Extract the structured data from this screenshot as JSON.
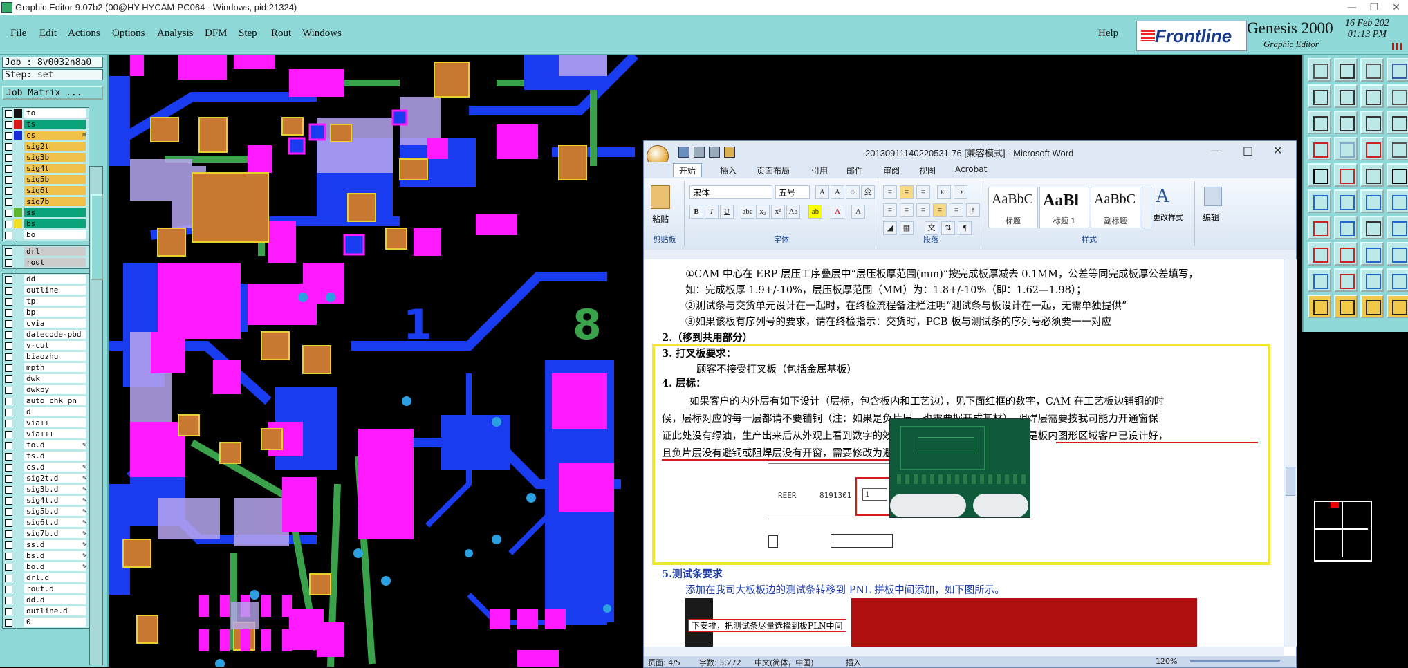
{
  "window": {
    "title": "Graphic Editor 9.07b2 (00@HY-HYCAM-PC064 - Windows, pid:21324)"
  },
  "menu": {
    "items": [
      "File",
      "Edit",
      "Actions",
      "Options",
      "Analysis",
      "DFM",
      "Step",
      "Rout",
      "Windows"
    ],
    "help": "Help"
  },
  "brand": {
    "logo_text": "Frontline",
    "product": "Genesis 2000",
    "subtitle": "Graphic Editor",
    "date_line1": "16 Feb 202",
    "time_line2": "01:13 PM"
  },
  "job": {
    "job_label": "Job : 8v0032n8a0",
    "step_label": "Step: set",
    "matrix_button": "Job Matrix ..."
  },
  "layers_group1": [
    {
      "name": "to",
      "swatch": "#111111",
      "bg": "#ffffff"
    },
    {
      "name": "ts",
      "swatch": "#d81818",
      "bg": "#0aa37a"
    },
    {
      "name": "cs",
      "swatch": "#1a2cd8",
      "bg": "#f0c24a",
      "edit": "≡"
    },
    {
      "name": "sig2t",
      "swatch": "",
      "bg": "#f0c24a"
    },
    {
      "name": "sig3b",
      "swatch": "",
      "bg": "#f0c24a"
    },
    {
      "name": "sig4t",
      "swatch": "",
      "bg": "#f0c24a"
    },
    {
      "name": "sig5b",
      "swatch": "",
      "bg": "#f0c24a"
    },
    {
      "name": "sig6t",
      "swatch": "",
      "bg": "#f0c24a"
    },
    {
      "name": "sig7b",
      "swatch": "",
      "bg": "#f0c24a"
    },
    {
      "name": "ss",
      "swatch": "#5ab82a",
      "bg": "#0aa37a"
    },
    {
      "name": "bs",
      "swatch": "#f0e020",
      "bg": "#0aa37a"
    },
    {
      "name": "bo",
      "swatch": "",
      "bg": "#ffffff"
    }
  ],
  "layers_group2": [
    {
      "name": "drl",
      "bg": "#cccccc"
    },
    {
      "name": "rout",
      "bg": "#cccccc"
    }
  ],
  "layers_group3": [
    {
      "name": "dd",
      "edit": ""
    },
    {
      "name": "outline",
      "edit": ""
    },
    {
      "name": "tp",
      "edit": ""
    },
    {
      "name": "bp",
      "edit": ""
    },
    {
      "name": "cvia",
      "edit": ""
    },
    {
      "name": "datecode-pbd",
      "edit": ""
    },
    {
      "name": "v-cut",
      "edit": ""
    },
    {
      "name": "biaozhu",
      "edit": ""
    },
    {
      "name": "mpth",
      "edit": ""
    },
    {
      "name": "dwk",
      "edit": ""
    },
    {
      "name": "dwkby",
      "edit": ""
    },
    {
      "name": "auto_chk_pn",
      "edit": ""
    },
    {
      "name": "d",
      "edit": ""
    },
    {
      "name": "via++",
      "edit": ""
    },
    {
      "name": "via+++",
      "edit": ""
    },
    {
      "name": "to.d",
      "edit": "✎"
    },
    {
      "name": "ts.d",
      "edit": ""
    },
    {
      "name": "cs.d",
      "edit": "✎"
    },
    {
      "name": "sig2t.d",
      "edit": "✎"
    },
    {
      "name": "sig3b.d",
      "edit": "✎"
    },
    {
      "name": "sig4t.d",
      "edit": "✎"
    },
    {
      "name": "sig5b.d",
      "edit": "✎"
    },
    {
      "name": "sig6t.d",
      "edit": "✎"
    },
    {
      "name": "sig7b.d",
      "edit": "✎"
    },
    {
      "name": "ss.d",
      "edit": "✎"
    },
    {
      "name": "bs.d",
      "edit": "✎"
    },
    {
      "name": "bo.d",
      "edit": "✎"
    },
    {
      "name": "drl.d",
      "edit": ""
    },
    {
      "name": "rout.d",
      "edit": ""
    },
    {
      "name": "dd.d",
      "edit": ""
    },
    {
      "name": "outline.d",
      "edit": ""
    },
    {
      "name": "0",
      "edit": ""
    }
  ],
  "canvas": {
    "label_1": "1",
    "label_8": "8"
  },
  "word": {
    "title": "20130911140220531-76 [兼容模式] - Microsoft Word",
    "tabs": [
      "开始",
      "插入",
      "页面布局",
      "引用",
      "邮件",
      "审阅",
      "视图",
      "Acrobat"
    ],
    "font_name": "宋体",
    "font_size": "五号",
    "groups": {
      "clipboard": "剪贴板",
      "font": "字体",
      "paragraph": "段落",
      "styles": "样式",
      "paste": "粘贴",
      "change_styles": "更改样式",
      "edit": "编辑"
    },
    "styles": [
      {
        "sample": "AaBbC",
        "label": "标题"
      },
      {
        "sample": "AaBl",
        "label": "标题 1"
      },
      {
        "sample": "AaBbC",
        "label": "副标题"
      }
    ],
    "doc": {
      "l1": "①CAM 中心在 ERP 层压工序叠层中“层压板厚范围(mm)“按完成板厚减去 0.1MM，公差等同完成板厚公差填写，",
      "l2": "如：完成板厚 1.9+/-10%，层压板厚范围（MM）为：1.8+/-10%（即：1.62—1.98）；",
      "l3": "②测试条与交货单元设计在一起时，在终检流程备注栏注明“测试条与板设计在一起，无需单独提供”",
      "l4": "③如果该板有序列号的要求，请在终检指示：交货时，PCB 板与测试条的序列号必须要一一对应",
      "l5": "2.（移到共用部分）",
      "l6": "3.  打叉板要求：",
      "l7": "顾客不接受打叉板（包括金属基板）",
      "l8": "4. 层标：",
      "l9": "如果客户的内外层有如下设计（层标，包含板内和工艺边），见下面红框的数字，CAM 在工艺板边铺铜的时",
      "l10": "候，层标对应的每一层都请不要铺铜（注：如果是负片层，也需要掘开成基材），阻焊层需要按我司能力开通窗保",
      "l11": "证此处没有绿油，生产出来后从外观上看到数字的效果（见下面绿色的图片）。如果是板内图形区域客户已设计好，",
      "l12": "且负片层没有避铜或阻焊层没有开窗，需要修改为避铜和开通窗。",
      "fig_reer": "REER",
      "fig_code": "8191301",
      "fig_box": "1",
      "l13": "5.测试条要求",
      "l14": "添加在我司大板板边的测试条转移到 PNL 拼板中间添加，如下图所示。",
      "l15": "下安排，把测试条尽量选择到板PLN中间"
    },
    "status": {
      "page": "页面: 4/5",
      "words": "字数: 3,272",
      "lang": "中文(简体，中国)",
      "mode": "插入",
      "zoom": "120%"
    }
  }
}
